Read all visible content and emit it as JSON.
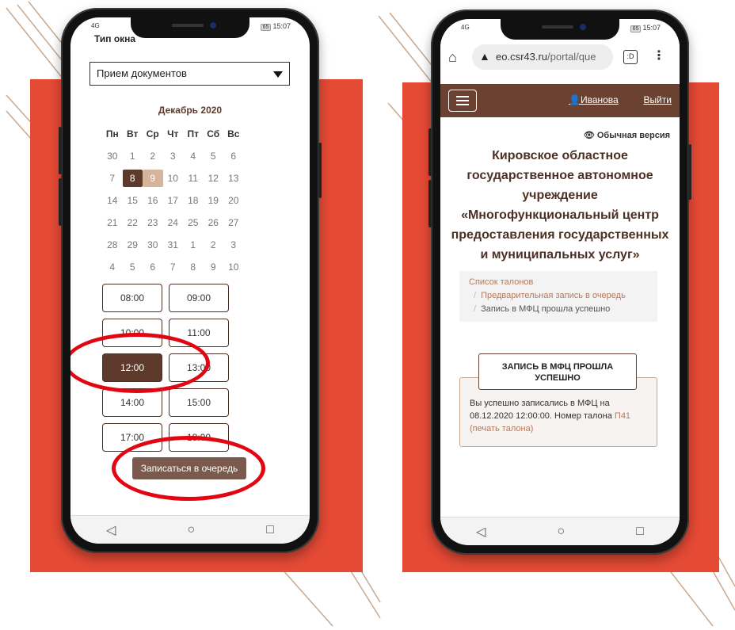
{
  "left_phone": {
    "status": {
      "signal": "4G",
      "battery": "65",
      "time": "15:07"
    },
    "window_type_label": "Тип окна",
    "window_type_value": "Прием документов",
    "month": "Декабрь 2020",
    "weekdays": [
      "Пн",
      "Вт",
      "Ср",
      "Чт",
      "Пт",
      "Сб",
      "Вс"
    ],
    "days": [
      "30",
      "1",
      "2",
      "3",
      "4",
      "5",
      "6",
      "7",
      "8",
      "9",
      "10",
      "11",
      "12",
      "13",
      "14",
      "15",
      "16",
      "17",
      "18",
      "19",
      "20",
      "21",
      "22",
      "23",
      "24",
      "25",
      "26",
      "27",
      "28",
      "29",
      "30",
      "31",
      "1",
      "2",
      "3",
      "4",
      "5",
      "6",
      "7",
      "8",
      "9",
      "10"
    ],
    "selected_day": "8",
    "highlighted_day": "9",
    "time_slots": [
      "08:00",
      "09:00",
      "10:00",
      "11:00",
      "12:00",
      "13:00",
      "14:00",
      "15:00",
      "17:00",
      "18:00"
    ],
    "selected_slot": "12:00",
    "queue_button": "Записаться в очередь"
  },
  "right_phone": {
    "status": {
      "signal": "4G",
      "battery": "65",
      "time": "15:07"
    },
    "url_host": "eo.csr43.ru",
    "url_path": "/portal/que",
    "tabs_count": ":D",
    "user_name": "Иванова",
    "logout": "Выйти",
    "normal_version": "Обычная версия",
    "org_lines": [
      "Кировское областное",
      "государственное автономное",
      "учреждение",
      "«Многофункциональный центр",
      "предоставления государственных",
      "и муниципальных услуг»"
    ],
    "breadcrumbs": [
      "Список талонов",
      "Предварительная запись в очередь",
      "Запись в МФЦ прошла успешно"
    ],
    "success_title": "ЗАПИСЬ В МФЦ ПРОШЛА УСПЕШНО",
    "success_text": "Вы успешно записались в МФЦ на 08.12.2020 12:00:00. Номер талона",
    "ticket_number": "П41",
    "print_link": "(печать талона)"
  },
  "colors": {
    "accent_red": "#e54a35",
    "brown": "#6b4131",
    "circle_red": "#e20613"
  }
}
